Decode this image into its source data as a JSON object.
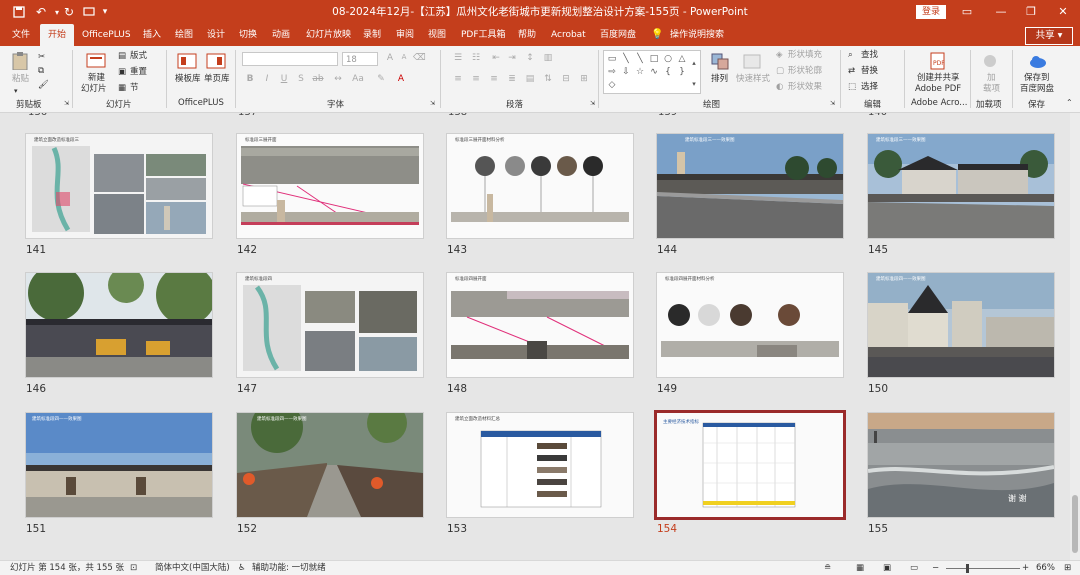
{
  "titlebar": {
    "doc_title": "08-2024年12月-【江苏】瓜州文化老街城市更新规划整治设计方案-155页  -  PowerPoint",
    "login_label": "登录"
  },
  "menu": {
    "tabs": [
      "文件",
      "开始",
      "OfficePLUS",
      "插入",
      "绘图",
      "设计",
      "切换",
      "动画",
      "幻灯片放映",
      "录制",
      "审阅",
      "视图",
      "PDF工具箱",
      "帮助",
      "Acrobat",
      "百度网盘"
    ],
    "tell_me": "操作说明搜索",
    "share_label": "共享"
  },
  "ribbon": {
    "clipboard": {
      "paste": "粘贴",
      "label": "剪贴板"
    },
    "slides": {
      "new_slide_1": "新建",
      "new_slide_2": "幻灯片",
      "layout": "版式",
      "reset": "重置",
      "section": "节",
      "label": "幻灯片"
    },
    "officeplus": {
      "template": "模板库",
      "single_page": "单页库",
      "label": "OfficePLUS"
    },
    "font": {
      "font_size": "18",
      "label": "字体"
    },
    "paragraph": {
      "label": "段落"
    },
    "drawing": {
      "arrange": "排列",
      "quick_styles": "快速样式",
      "fill": "形状填充",
      "outline": "形状轮廓",
      "effects": "形状效果",
      "label": "绘图"
    },
    "editing": {
      "find": "查找",
      "replace": "替换",
      "select": "选择",
      "label": "编辑"
    },
    "adobe": {
      "line1": "创建并共享",
      "line2": "Adobe PDF",
      "label": "Adobe Acro..."
    },
    "addins": {
      "line1": "加",
      "line2": "载项",
      "label": "加载项"
    },
    "save": {
      "line1": "保存到",
      "line2": "百度网盘",
      "label": "保存"
    }
  },
  "slides": [
    {
      "num": "141",
      "title": "建筑立面改造标准段三"
    },
    {
      "num": "142",
      "title": "标准段三展开面"
    },
    {
      "num": "143",
      "title": "标准段三展开面材料分析"
    },
    {
      "num": "144",
      "title": "建筑标准段三——效果图"
    },
    {
      "num": "145",
      "title": "建筑标准段三——效果图"
    },
    {
      "num": "146",
      "title": ""
    },
    {
      "num": "147",
      "title": "建筑标准段四"
    },
    {
      "num": "148",
      "title": "标准段四展开面"
    },
    {
      "num": "149",
      "title": "标准段四展开面材料分析"
    },
    {
      "num": "150",
      "title": "建筑标准段四——效果图"
    },
    {
      "num": "151",
      "title": "建筑标准段四——效果图"
    },
    {
      "num": "152",
      "title": "建筑标准段四——效果图"
    },
    {
      "num": "153",
      "title": "建筑立面改造材料汇总"
    },
    {
      "num": "154",
      "title": "主要经济技术指标"
    },
    {
      "num": "155",
      "title": "谢  谢"
    }
  ],
  "selected_slide": "154",
  "status": {
    "slide_info": "幻灯片 第 154 张，共 155 张",
    "language": "简体中文(中国大陆)",
    "accessibility": "辅助功能: 一切就绪",
    "notes": "备注",
    "zoom": "66%"
  },
  "colors": {
    "accent": "#c43e1c",
    "selected_border": "#9a2a2a"
  }
}
